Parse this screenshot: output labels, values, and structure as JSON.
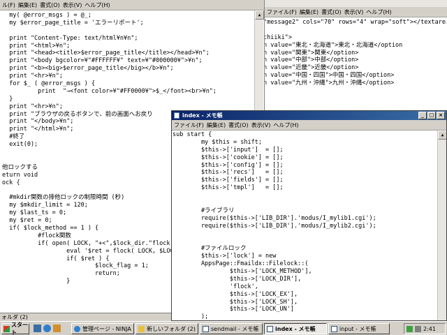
{
  "left_window": {
    "code_lines": [
      "  my( @error_msgs ) = @_;",
      "  my $error_page_title = 'エラーリポート';",
      "",
      "  print \"Content-Type: text/html¥n¥n\";",
      "  print \"<html>¥n\";",
      "  print \"<head><title>$error_page_title</title></head>¥n\";",
      "  print \"<body bgcolor=¥\"#FFFFFF¥\" text=¥\"#000000¥\">¥n\";",
      "  print \"<b><big>$error_page_title</big></b>¥n\";",
      "  print \"<hr>¥n\";",
      "  for $_ ( @error_msgs ) {",
      "          print  \"→<font color=¥\"#FF0000¥\">$_</font><br>¥n\";",
      "  }",
      "  print \"<hr>¥n\";",
      "  print \"ブラウザの戻るボタンで、前の画面へお戻り",
      "  print \"</body>¥n\";",
      "  print \"</html>¥n\";",
      "  #終了",
      "  exit(0);",
      "",
      "",
      "他ロックする",
      "eturn void",
      "ock {",
      "",
      "  #mkdir関数の排他ロックの制限時間 (秒)",
      "  my $mkdir_limit = 120;",
      "  my $last_ts = 0;",
      "  my $ret = 0;",
      "  if( $lock_method == 1 ) {",
      "          #flock関数",
      "          if( open( LOCK, \"+<\",$lock_dir.\"flock.",
      "                  eval '$ret = flock( LOCK, $LOC",
      "                  if( $ret ) {",
      "                          $lock_flag = 1;",
      "                          return;",
      "                  }"
    ],
    "status_label": "ォルダ (2)"
  },
  "right_window": {
    "menu": [
      "ファイル(F)",
      "編集(E)",
      "書式(O)",
      "表示(V)",
      "ヘルプ(H)"
    ],
    "code_lines": [
      "\"message2\" cols=\"70\" rows=\"4\" wrap=\"soft\"></textarea",
      "",
      "chiiki\">",
      "n value=\"東北・北海道\">東北・北海道</option",
      "n value=\"関東\">関東</option>",
      "n value=\"中部\">中部</option>",
      "n value=\"近畿\">近畿</option>",
      "n value=\"中国・四国\">中国・四国</option>",
      "n value=\"九州・沖縄\">九州・沖縄</option>"
    ]
  },
  "top_left_menu": [
    "ル(F)",
    "編集(E)",
    "書式(O)",
    "表示(V)",
    "ヘルプ(H)"
  ],
  "index_window": {
    "title": "index - メモ帳",
    "menu": [
      "ファイル(F)",
      "編集(E)",
      "書式(O)",
      "表示(V)",
      "ヘルプ(H)"
    ],
    "code_lines": [
      "sub start {",
      "        my $this = shift;",
      "        $this->['input']  = [];",
      "        $this->['cookie'] = [];",
      "        $this->['config'] = [];",
      "        $this->['recs']   = [];",
      "        $this->['fields'] = [];",
      "        $this->['tmpl']   = [];",
      "",
      "",
      "        #ライブラリ",
      "        require($this->['LIB_DIR'].'modus/I_mylib1.cgi');",
      "        require($this->['LIB_DIR'].'modus/I_mylib2.cgi');",
      "",
      "",
      "        #ファイルロック",
      "        $this->['lock'] = new",
      "        AppsPage::Fmaildx::Filelock::(",
      "                $this->['LOCK_METHOD'],",
      "                $this->['LOCK_DIR'],",
      "                'flock',",
      "                $this->['LOCK_EX'],",
      "                $this->['LOCK_SH'],",
      "                $this->['LOCK_UN']",
      "        );"
    ]
  },
  "taskbar": {
    "start_label": "スタート",
    "items": [
      {
        "label": "管理ページ - NINJA ...",
        "icon": "browser-icon"
      },
      {
        "label": "新しいフォルダ (2)",
        "icon": "folder-icon"
      },
      {
        "label": "sendmail - メモ帳",
        "icon": "notepad-icon"
      },
      {
        "label": "index - メモ帳",
        "icon": "notepad-icon",
        "active": true
      },
      {
        "label": "input - メモ帳",
        "icon": "notepad-icon"
      }
    ],
    "clock": "2:41"
  },
  "colors": {
    "titlebar_active": "#0a246a",
    "chrome": "#d4d0c8"
  }
}
